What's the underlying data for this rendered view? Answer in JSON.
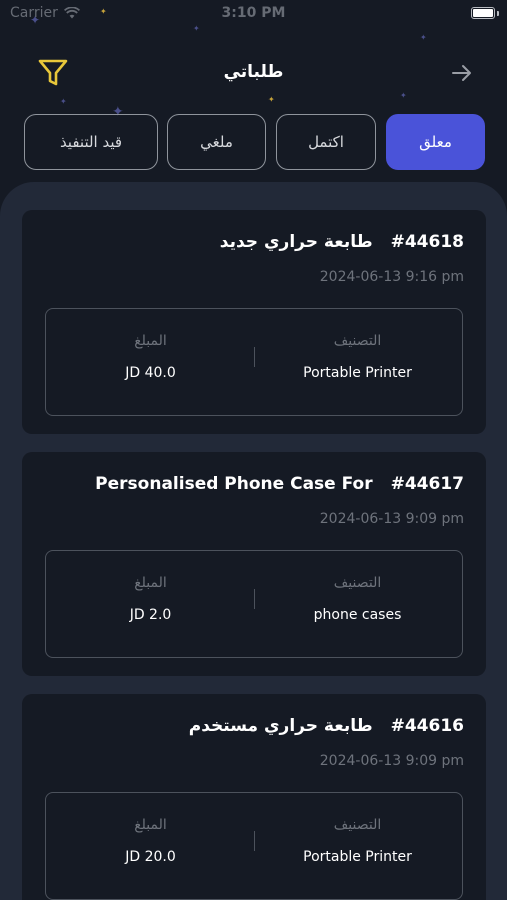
{
  "status_bar": {
    "carrier": "Carrier",
    "time": "3:10 PM",
    "wifi_icon": "wifi-icon",
    "battery_icon": "battery-icon"
  },
  "header": {
    "title": "طلباتي",
    "filter_icon": "filter-icon",
    "back_icon": "arrow-right-icon",
    "accent_color": "#e8c73a"
  },
  "tabs": [
    {
      "label": "معلق",
      "active": true
    },
    {
      "label": "اكتمل",
      "active": false
    },
    {
      "label": "ملغي",
      "active": false
    },
    {
      "label": "قيد التنفيذ",
      "active": false
    }
  ],
  "colors": {
    "background": "#151a24",
    "panel": "#222938",
    "active_tab": "#4a53d9",
    "muted_text": "#6e737c"
  },
  "orders": [
    {
      "number": "#44618",
      "name": "طابعة حراري جديد",
      "date": "2024-06-13 9:16 pm",
      "category_label": "التصنيف",
      "category": "Portable Printer",
      "amount_label": "المبلغ",
      "amount": "JD 40.0"
    },
    {
      "number": "#44617",
      "name": "Personalised Phone Case For",
      "date": "2024-06-13 9:09 pm",
      "category_label": "التصنيف",
      "category": "phone cases",
      "amount_label": "المبلغ",
      "amount": "JD 2.0"
    },
    {
      "number": "#44616",
      "name": "طابعة حراري مستخدم",
      "date": "2024-06-13 9:09 pm",
      "category_label": "التصنيف",
      "category": "Portable Printer",
      "amount_label": "المبلغ",
      "amount": "JD 20.0"
    }
  ]
}
